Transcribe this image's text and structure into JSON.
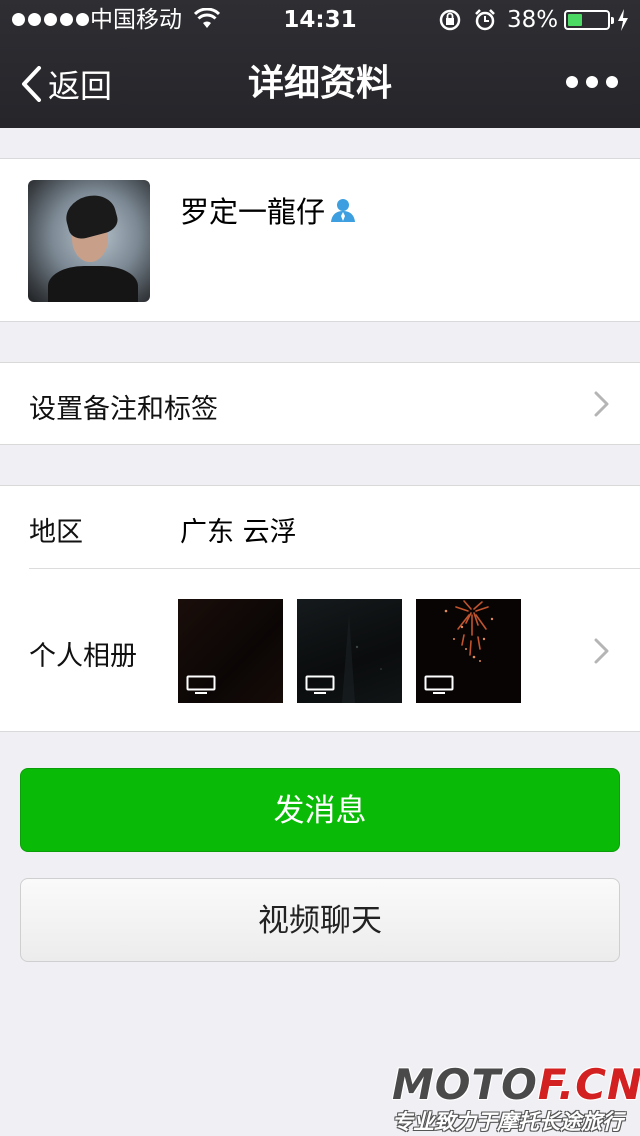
{
  "status_bar": {
    "carrier": "中国移动",
    "time": "14:31",
    "battery_percent_label": "38%",
    "battery_level": 0.38,
    "signal_dots": 5
  },
  "nav": {
    "back_label": "返回",
    "title": "详细资料"
  },
  "profile": {
    "nickname": "罗定一龍仔",
    "contact_icon_color": "#3d9fe0"
  },
  "remark": {
    "label": "设置备注和标签"
  },
  "info": {
    "region_label": "地区",
    "region_value": "广东  云浮",
    "album_label": "个人相册"
  },
  "actions": {
    "send_message": "发消息",
    "video_chat": "视频聊天"
  },
  "watermark": {
    "brand_a": "MOTO",
    "brand_b": "F.CN",
    "slogan": "专业致力于摩托长途旅行"
  },
  "colors": {
    "nav_bg": "#2b2b30",
    "primary_green": "#09bb07",
    "page_bg": "#efeff4"
  }
}
